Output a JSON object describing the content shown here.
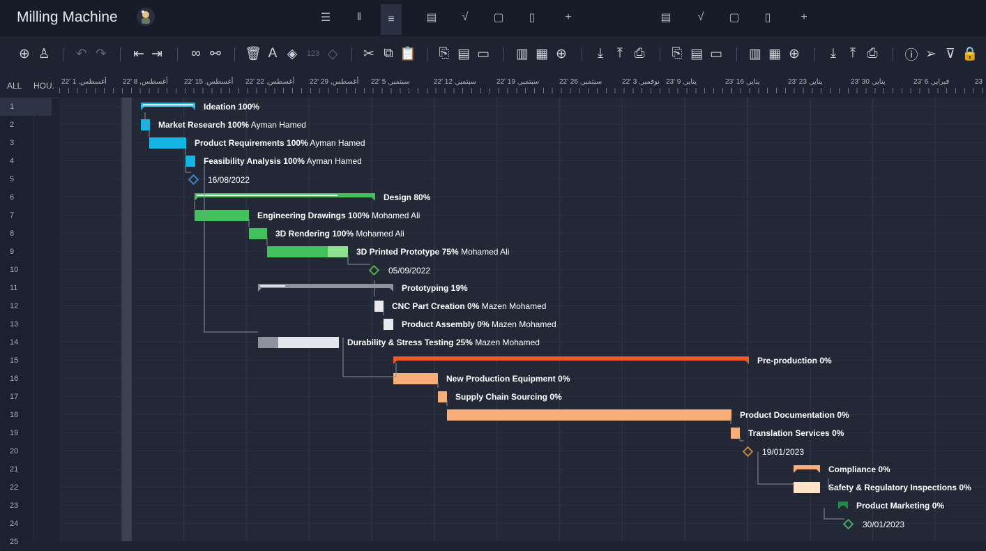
{
  "app": {
    "title": "Milling Machine"
  },
  "views": [
    "list-view-icon",
    "board-view-icon",
    "gantt-view-icon",
    "sheet-view-icon",
    "dashboard-view-icon",
    "calendar-view-icon",
    "files-view-icon",
    "add-view-icon"
  ],
  "views_glyphs": [
    "☰",
    "ǁ",
    "≡",
    "▤",
    "√",
    "▢",
    "▯",
    "+"
  ],
  "toolbar": {
    "items": [
      {
        "name": "add-task-icon",
        "glyph": "⊕"
      },
      {
        "name": "add-user-icon",
        "glyph": "♙"
      },
      {
        "name": "undo-icon",
        "glyph": "↶"
      },
      {
        "name": "redo-icon",
        "glyph": "↷"
      },
      {
        "name": "outdent-icon",
        "glyph": "⇤"
      },
      {
        "name": "indent-icon",
        "glyph": "⇥"
      },
      {
        "name": "link-icon",
        "glyph": "∞"
      },
      {
        "name": "unlink-icon",
        "glyph": "⚯"
      },
      {
        "name": "delete-icon",
        "glyph": "🗑"
      },
      {
        "name": "text-color-icon",
        "glyph": "A"
      },
      {
        "name": "fill-color-icon",
        "glyph": "◈"
      },
      {
        "name": "number-format-icon",
        "glyph": "123"
      },
      {
        "name": "milestone-icon",
        "glyph": "◇"
      },
      {
        "name": "cut-icon",
        "glyph": "✂"
      },
      {
        "name": "copy-icon",
        "glyph": "⧉"
      },
      {
        "name": "paste-icon",
        "glyph": "📋"
      },
      {
        "name": "attachment-icon",
        "glyph": "⎘"
      },
      {
        "name": "notes-icon",
        "glyph": "▤"
      },
      {
        "name": "comment-icon",
        "glyph": "▭"
      },
      {
        "name": "columns-icon",
        "glyph": "▥"
      },
      {
        "name": "grid-icon",
        "glyph": "▦"
      },
      {
        "name": "zoom-icon",
        "glyph": "⊕"
      },
      {
        "name": "import-icon",
        "glyph": "⤓"
      },
      {
        "name": "export-icon",
        "glyph": "⤒"
      },
      {
        "name": "print-icon",
        "glyph": "⎙"
      },
      {
        "name": "info-icon",
        "glyph": "ⓘ"
      },
      {
        "name": "send-icon",
        "glyph": "➢"
      },
      {
        "name": "filter-icon",
        "glyph": "⊽"
      },
      {
        "name": "lock-icon",
        "glyph": "🔒"
      }
    ]
  },
  "grid_headers": {
    "all": "ALL",
    "hours": "HOU."
  },
  "timeline_dates": [
    "22' 1 ,أغسطس",
    "22' 8 ,أغسطس",
    "22' 15 ,أغسطس",
    "22' 22 ,أغسطس",
    "22' 29 ,أغسطس",
    "22' 5 ,سبتمبر",
    "22' 12 ,سبتمبر",
    "22' 19 ,سبتمبر",
    "22' 26 ,سبتمبر",
    "22' 3 ,نوفمبر",
    "23' 9 ,يناير",
    "23' 16 ,يناير",
    "23' 23 ,يناير",
    "23' 30 ,يناير",
    "23' 6 ,فبراير",
    "23"
  ],
  "rows": [
    "1",
    "2",
    "3",
    "4",
    "5",
    "6",
    "7",
    "8",
    "9",
    "10",
    "11",
    "12",
    "13",
    "14",
    "15",
    "16",
    "17",
    "18",
    "19",
    "20",
    "21",
    "22",
    "23",
    "24",
    "25"
  ],
  "tasks": [
    {
      "row": 1,
      "type": "summary",
      "name": "Ideation",
      "pct": "100%",
      "who": "",
      "color": "#13b5e3",
      "progress": 1.0
    },
    {
      "row": 2,
      "type": "task",
      "name": "Market Research",
      "pct": "100%",
      "who": "Ayman Hamed",
      "color": "#13b5e3",
      "progress": 1.0
    },
    {
      "row": 3,
      "type": "task",
      "name": "Product Requirements",
      "pct": "100%",
      "who": "Ayman Hamed",
      "color": "#13b5e3",
      "progress": 1.0
    },
    {
      "row": 4,
      "type": "task",
      "name": "Feasibility Analysis",
      "pct": "100%",
      "who": "Ayman Hamed",
      "color": "#13b5e3",
      "progress": 1.0
    },
    {
      "row": 5,
      "type": "milestone",
      "date": "16/08/2022",
      "color": "#3a86c8"
    },
    {
      "row": 6,
      "type": "summary",
      "name": "Design",
      "pct": "80%",
      "who": "",
      "color": "#43c15a",
      "progress": 0.8
    },
    {
      "row": 7,
      "type": "task",
      "name": "Engineering Drawings",
      "pct": "100%",
      "who": "Mohamed Ali",
      "color": "#43c15a",
      "progress": 1.0
    },
    {
      "row": 8,
      "type": "task",
      "name": "3D Rendering",
      "pct": "100%",
      "who": "Mohamed Ali",
      "color": "#43c15a",
      "progress": 1.0
    },
    {
      "row": 9,
      "type": "task",
      "name": "3D Printed Prototype",
      "pct": "75%",
      "who": "Mohamed Ali",
      "color": "#43c15a",
      "progress": 0.75
    },
    {
      "row": 10,
      "type": "milestone",
      "date": "05/09/2022",
      "color": "#5fa84a"
    },
    {
      "row": 11,
      "type": "summary",
      "name": "Prototyping",
      "pct": "19%",
      "who": "",
      "color": "#8d939e",
      "progress": 0.19
    },
    {
      "row": 12,
      "type": "task",
      "name": "CNC Part Creation",
      "pct": "0%",
      "who": "Mazen Mohamed",
      "color": "#e8eaf0",
      "progress": 0
    },
    {
      "row": 13,
      "type": "task",
      "name": "Product Assembly",
      "pct": "0%",
      "who": "Mazen Mohamed",
      "color": "#e8eaf0",
      "progress": 0
    },
    {
      "row": 14,
      "type": "task",
      "name": "Durability & Stress Testing",
      "pct": "25%",
      "who": "Mazen Mohamed",
      "color": "#e3e6ee",
      "progress": 0.25
    },
    {
      "row": 15,
      "type": "summary",
      "name": "Pre-production",
      "pct": "0%",
      "who": "",
      "color": "#f0582a",
      "progress": 0
    },
    {
      "row": 16,
      "type": "task",
      "name": "New Production Equipment",
      "pct": "0%",
      "who": "",
      "color": "#f7ae78",
      "progress": 0
    },
    {
      "row": 17,
      "type": "task",
      "name": "Supply Chain Sourcing",
      "pct": "0%",
      "who": "",
      "color": "#f7ae78",
      "progress": 0
    },
    {
      "row": 18,
      "type": "task",
      "name": "Product Documentation",
      "pct": "0%",
      "who": "",
      "color": "#f7ae78",
      "progress": 0
    },
    {
      "row": 19,
      "type": "task",
      "name": "Translation Services",
      "pct": "0%",
      "who": "",
      "color": "#f7ae78",
      "progress": 0
    },
    {
      "row": 20,
      "type": "milestone",
      "date": "19/01/2023",
      "color": "#c9843f"
    },
    {
      "row": 21,
      "type": "summary",
      "name": "Compliance",
      "pct": "0%",
      "who": "",
      "color": "#f7ae78",
      "progress": 0
    },
    {
      "row": 22,
      "type": "task",
      "name": "Safety & Regulatory Inspections",
      "pct": "0%",
      "who": "",
      "color": "#ffe3c9",
      "progress": 0
    },
    {
      "row": 23,
      "type": "summary",
      "name": "Product Marketing",
      "pct": "0%",
      "who": "",
      "color": "#1e8a4a",
      "progress": 0
    },
    {
      "row": 24,
      "type": "milestone",
      "date": "30/01/2023",
      "color": "#4ea86a"
    }
  ]
}
